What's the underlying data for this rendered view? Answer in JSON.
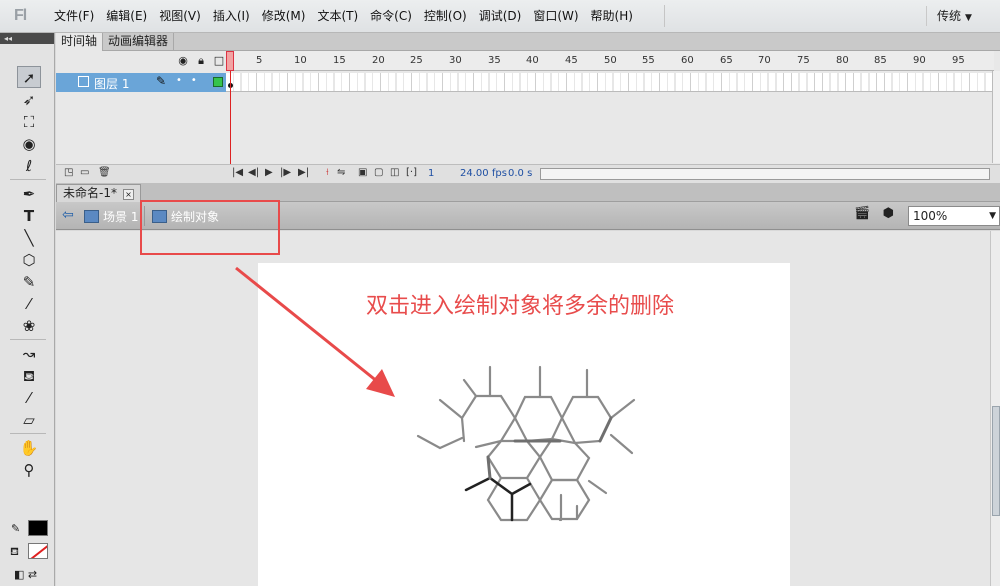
{
  "app": {
    "logo": "Fl"
  },
  "menu": [
    "文件(F)",
    "编辑(E)",
    "视图(V)",
    "插入(I)",
    "修改(M)",
    "文本(T)",
    "命令(C)",
    "控制(O)",
    "调试(D)",
    "窗口(W)",
    "帮助(H)"
  ],
  "workspace": {
    "label": "传统"
  },
  "timeline": {
    "tabs": [
      "时间轴",
      "动画编辑器"
    ],
    "layer_name": "图层 1",
    "ruler_numbers": [
      "1",
      "5",
      "10",
      "15",
      "20",
      "25",
      "30",
      "35",
      "40",
      "45",
      "50",
      "55",
      "60",
      "65",
      "70",
      "75",
      "80",
      "85",
      "90",
      "95"
    ],
    "current_frame": "1",
    "fps": "24.00",
    "fps_unit": "fps",
    "elapsed": "0.0",
    "elapsed_unit": "s"
  },
  "document": {
    "tab_title": "未命名-1*",
    "close_glyph": "×"
  },
  "editbar": {
    "back_glyph": "⇦",
    "scene_label": "场景 1",
    "object_label": "绘制对象",
    "zoom": "100%"
  },
  "annotation": {
    "text": "双击进入绘制对象将多余的删除",
    "color": "#e84c4c"
  },
  "colors": {
    "layer_highlight": "#6aa5d8",
    "accent_red": "#e84a4a",
    "stage": "#ffffff"
  },
  "icons": {
    "tools": [
      "selection-tool-icon",
      "subselection-tool-icon",
      "free-transform-icon",
      "3d-rotation-icon",
      "lasso-icon",
      "pen-icon",
      "text-icon",
      "line-icon",
      "polystar-icon",
      "pencil-icon",
      "brush-icon",
      "deco-icon",
      "bone-icon",
      "paint-bucket-icon",
      "eyedropper-icon",
      "eraser-icon",
      "hand-icon",
      "zoom-icon"
    ]
  }
}
